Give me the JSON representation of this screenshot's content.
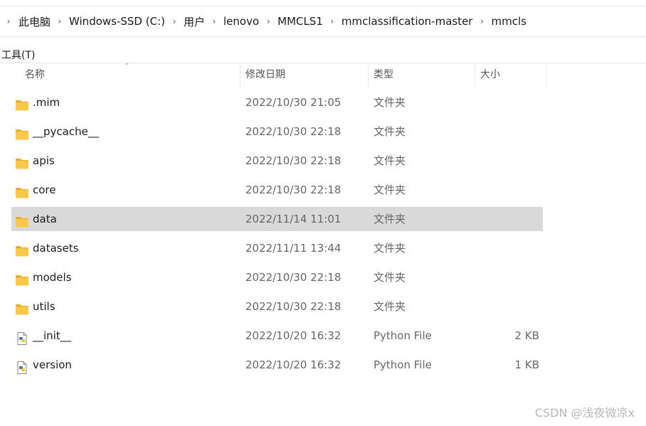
{
  "breadcrumb": [
    "此电脑",
    "Windows-SSD (C:)",
    "用户",
    "lenovo",
    "MMCLS1",
    "mmclassification-master",
    "mmcls"
  ],
  "menu": {
    "tools": "工具(T)"
  },
  "columns": {
    "name": "名称",
    "date": "修改日期",
    "type": "类型",
    "size": "大小"
  },
  "rows": [
    {
      "name": ".mim",
      "date": "2022/10/30 21:05",
      "type": "文件夹",
      "size": "",
      "icon": "folder-icon",
      "selected": false
    },
    {
      "name": "__pycache__",
      "date": "2022/10/30 22:18",
      "type": "文件夹",
      "size": "",
      "icon": "folder-icon",
      "selected": false
    },
    {
      "name": "apis",
      "date": "2022/10/30 22:18",
      "type": "文件夹",
      "size": "",
      "icon": "folder-icon",
      "selected": false
    },
    {
      "name": "core",
      "date": "2022/10/30 22:18",
      "type": "文件夹",
      "size": "",
      "icon": "folder-icon",
      "selected": false
    },
    {
      "name": "data",
      "date": "2022/11/14 11:01",
      "type": "文件夹",
      "size": "",
      "icon": "folder-icon",
      "selected": true
    },
    {
      "name": "datasets",
      "date": "2022/11/11 13:44",
      "type": "文件夹",
      "size": "",
      "icon": "folder-icon",
      "selected": false
    },
    {
      "name": "models",
      "date": "2022/10/30 22:18",
      "type": "文件夹",
      "size": "",
      "icon": "folder-icon",
      "selected": false
    },
    {
      "name": "utils",
      "date": "2022/10/30 22:18",
      "type": "文件夹",
      "size": "",
      "icon": "folder-icon",
      "selected": false
    },
    {
      "name": "__init__",
      "date": "2022/10/20 16:32",
      "type": "Python File",
      "size": "2 KB",
      "icon": "python-file-icon",
      "selected": false
    },
    {
      "name": "version",
      "date": "2022/10/20 16:32",
      "type": "Python File",
      "size": "1 KB",
      "icon": "python-file-icon",
      "selected": false
    }
  ],
  "watermark": "CSDN @浅夜微凉x",
  "colors": {
    "selected_row": "#d9d9d9",
    "folder": "#f8c84a",
    "folder_dark": "#e8a92c"
  }
}
